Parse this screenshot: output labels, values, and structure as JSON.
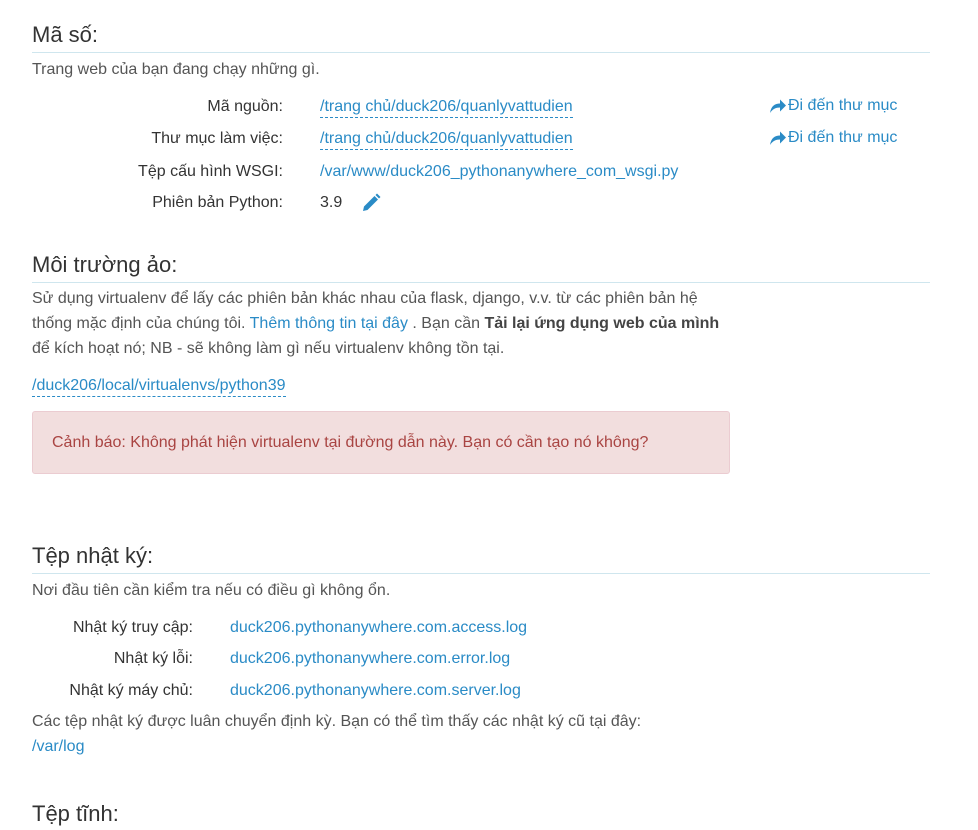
{
  "code": {
    "heading": "Mã số:",
    "description": "Trang web của bạn đang chạy những gì.",
    "rows": [
      {
        "label": "Mã nguồn:",
        "value": "/trang chủ/duck206/quanlyvattudien",
        "action": "Đi đến thư mục"
      },
      {
        "label": "Thư mục làm việc:",
        "value": "/trang chủ/duck206/quanlyvattudien",
        "action": "Đi đến thư mục"
      },
      {
        "label": "Tệp cấu hình WSGI:",
        "value": "/var/www/duck206_pythonanywhere_com_wsgi.py"
      },
      {
        "label": "Phiên bản Python:",
        "value": "3.9"
      }
    ]
  },
  "virtualenv": {
    "heading": "Môi trường ảo:",
    "text_1": "Sử dụng virtualenv để lấy các phiên bản khác nhau của flask, django, v.v. từ các phiên bản hệ thống mặc định của chúng tôi.",
    "more_info_link": "Thêm thông tin tại đây",
    "text_2": ". Bạn cần",
    "reload_bold": "Tải lại ứng dụng web của mình",
    "text_3": "để kích hoạt nó; NB - sẽ không làm gì nếu virtualenv không tồn tại.",
    "path": "/duck206/local/virtualenvs/python39",
    "warning": "Cảnh báo: Không phát hiện virtualenv tại đường dẫn này. Bạn có cần tạo nó không?"
  },
  "logs": {
    "heading": "Tệp nhật ký:",
    "description": "Nơi đầu tiên cần kiểm tra nếu có điều gì không ổn.",
    "rows": [
      {
        "label": "Nhật ký truy cập:",
        "value": "duck206.pythonanywhere.com.access.log"
      },
      {
        "label": "Nhật ký lỗi:",
        "value": "duck206.pythonanywhere.com.error.log"
      },
      {
        "label": "Nhật ký máy chủ:",
        "value": "duck206.pythonanywhere.com.server.log"
      }
    ],
    "rotation_note": "Các tệp nhật ký được luân chuyển định kỳ. Bạn có thể tìm thấy các nhật ký cũ tại đây:",
    "old_logs_link": "/var/log"
  },
  "static": {
    "heading": "Tệp tĩnh:"
  },
  "colors": {
    "link": "#2a8bc6",
    "alert_bg": "#f2dede",
    "alert_text": "#a94442",
    "rule": "#cfe6ee"
  },
  "icons": {
    "goto": "share-arrow-icon",
    "edit": "pencil-icon"
  }
}
